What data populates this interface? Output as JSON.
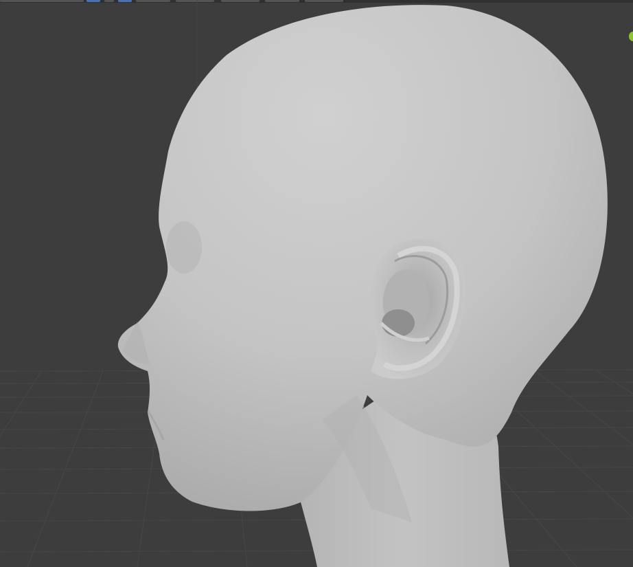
{
  "viewport": {
    "name": "3D Viewport",
    "background": "#3d3d3d",
    "grid_color": "#474747",
    "object": "sculpted-head"
  },
  "colors": {
    "mesh": "#c4c4c4",
    "mesh_shadow": "#9a9a9a",
    "header_button": "#545454",
    "header_button_active": "#4772b3",
    "gizmo_y_axis": "#8bc332"
  },
  "icons": [
    "header-buttons",
    "navigation-gizmo-y-axis"
  ]
}
